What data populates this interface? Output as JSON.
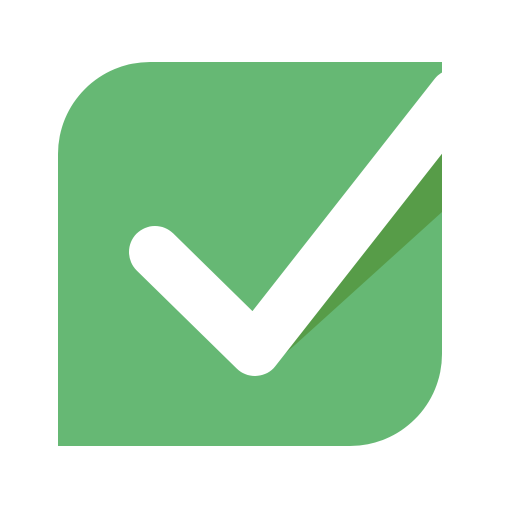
{
  "icon": {
    "name": "checkmark-icon",
    "colors": {
      "tile": "#66b874",
      "shadow": "#579c48",
      "check": "#ffffff",
      "background": "#ffffff"
    }
  }
}
